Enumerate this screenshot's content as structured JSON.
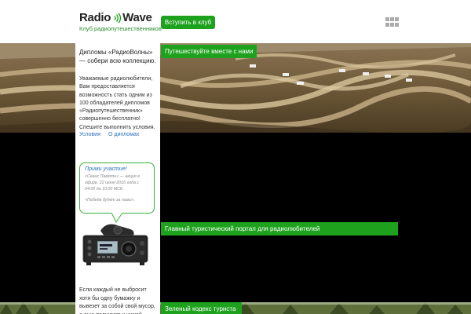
{
  "header": {
    "logo_left": "Radio",
    "logo_right": "Wave",
    "tagline": "Клуб радиопутешественников",
    "join_button": "Вступить в клуб",
    "menu_icon": "grid-icon"
  },
  "sidebar": {
    "title": "Дипломы «РадиоВолны» — собери всю коллекцию.",
    "text": "Уважаемые радиолюбители, Вам предоставляется возможность стать одним из 100 обладателей дипломов «Радиопутешественник» совершенно бесплатно! Спешите выполнить условия.",
    "links": [
      "Условия",
      "О дипломах"
    ],
    "bubble": {
      "title": "Прими участие!",
      "text": "«Сеанс Памяти» — акция в эфире, 22 июня 2016 года с 04:00 до 10:00 МСК.",
      "quote": "«Победа будет за нами»."
    },
    "bottom_text": "Если каждый не выбросит хотя бы одну бумажку и вывезет за собой свой мусор, а еще поднимет и чужой"
  },
  "banners": {
    "travel_together": "Путешествуйте вместе с нами",
    "portal": "Главный туристический портал для радиолюбителей",
    "green_code": "Зеленый кодекс туриста"
  },
  "colors": {
    "accent_green": "#1ea21e",
    "link_blue": "#2a6fba",
    "background": "#000000"
  }
}
